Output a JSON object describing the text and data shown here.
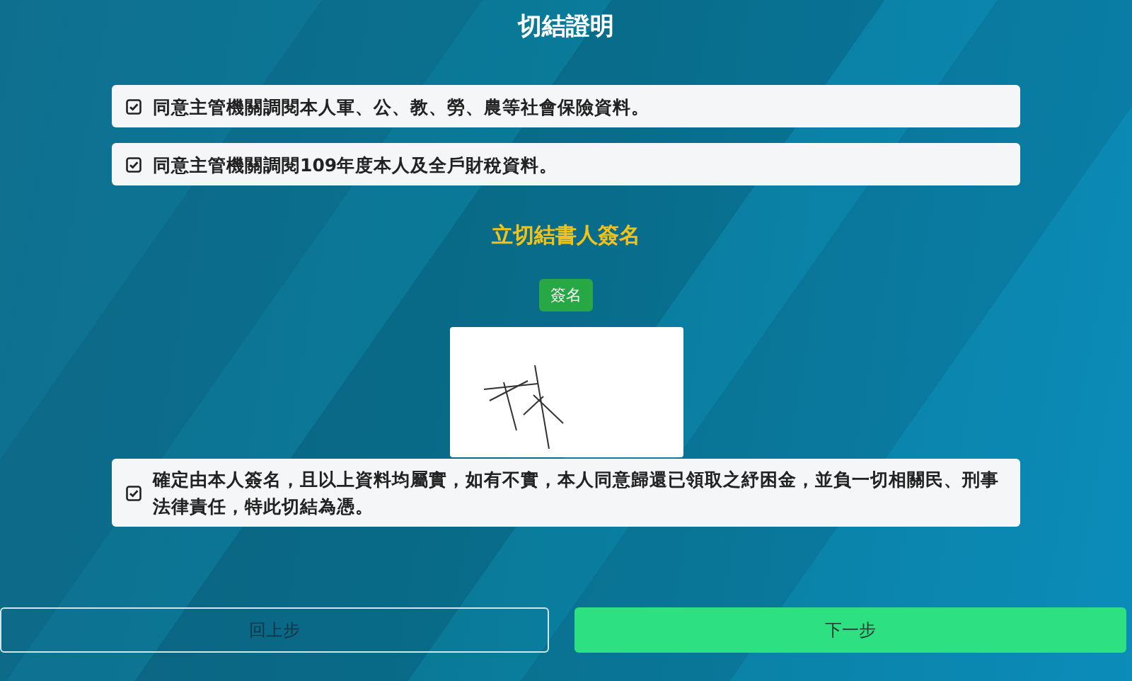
{
  "title": "切結證明",
  "consents": [
    {
      "text": "同意主管機關調閱本人軍、公、教、勞、農等社會保險資料。",
      "checked": true
    },
    {
      "text": "同意主管機關調閱109年度本人及全戶財稅資料。",
      "checked": true
    }
  ],
  "signature": {
    "heading": "立切結書人簽名",
    "button": "簽名",
    "signed": true
  },
  "declaration": {
    "text": "確定由本人簽名，且以上資料均屬實，如有不實，本人同意歸還已領取之紓困金，並負一切相關民、刑事法律責任，特此切結為憑。",
    "checked": true
  },
  "buttons": [
    {
      "label": "回上步",
      "kind": "secondary"
    },
    {
      "label": "下一步",
      "kind": "primary"
    }
  ]
}
